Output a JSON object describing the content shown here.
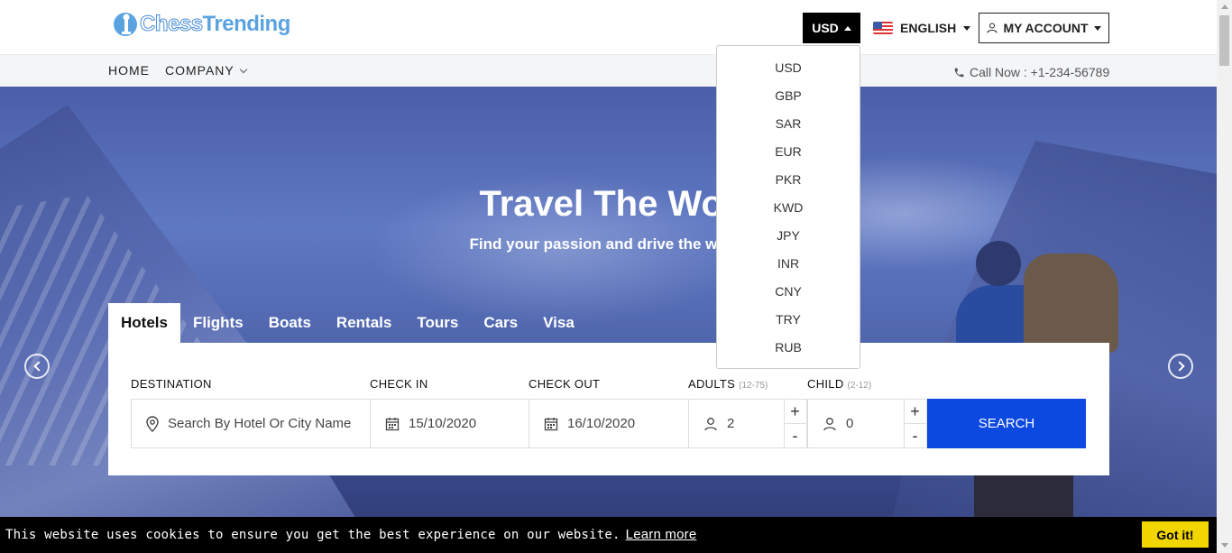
{
  "brand": {
    "name_part1": "Chess",
    "name_part2": "Trending"
  },
  "header": {
    "currency": "USD",
    "language": "ENGLISH",
    "account": "MY ACCOUNT"
  },
  "nav": {
    "items": [
      {
        "label": "HOME"
      },
      {
        "label": "COMPANY"
      }
    ],
    "call": "Call Now : +1-234-56789"
  },
  "currency_dropdown": {
    "options": [
      "USD",
      "GBP",
      "SAR",
      "EUR",
      "PKR",
      "KWD",
      "JPY",
      "INR",
      "CNY",
      "TRY",
      "RUB"
    ]
  },
  "hero": {
    "title": "Travel The Wor",
    "subtitle": "Find your passion and drive the way y"
  },
  "tabs": [
    {
      "label": "Hotels",
      "active": true
    },
    {
      "label": "Flights"
    },
    {
      "label": "Boats"
    },
    {
      "label": "Rentals"
    },
    {
      "label": "Tours"
    },
    {
      "label": "Cars"
    },
    {
      "label": "Visa"
    }
  ],
  "search": {
    "destination_label": "DESTINATION",
    "destination_placeholder": "Search By Hotel Or City Name",
    "checkin_label": "CHECK IN",
    "checkin_value": "15/10/2020",
    "checkout_label": "CHECK OUT",
    "checkout_value": "16/10/2020",
    "adults_label": "ADULTS",
    "adults_range": "(12-75)",
    "adults_value": "2",
    "child_label": "CHILD",
    "child_range": "(2-12)",
    "child_value": "0",
    "plus": "+",
    "minus": "-",
    "button": "SEARCH"
  },
  "cookie": {
    "text": "This website uses cookies to ensure you get the best experience on our website.",
    "link": "Learn more",
    "button": "Got it!"
  },
  "colors": {
    "primary": "#0c49e0",
    "cookie_button": "#f1d600",
    "header_dark": "#000000"
  }
}
